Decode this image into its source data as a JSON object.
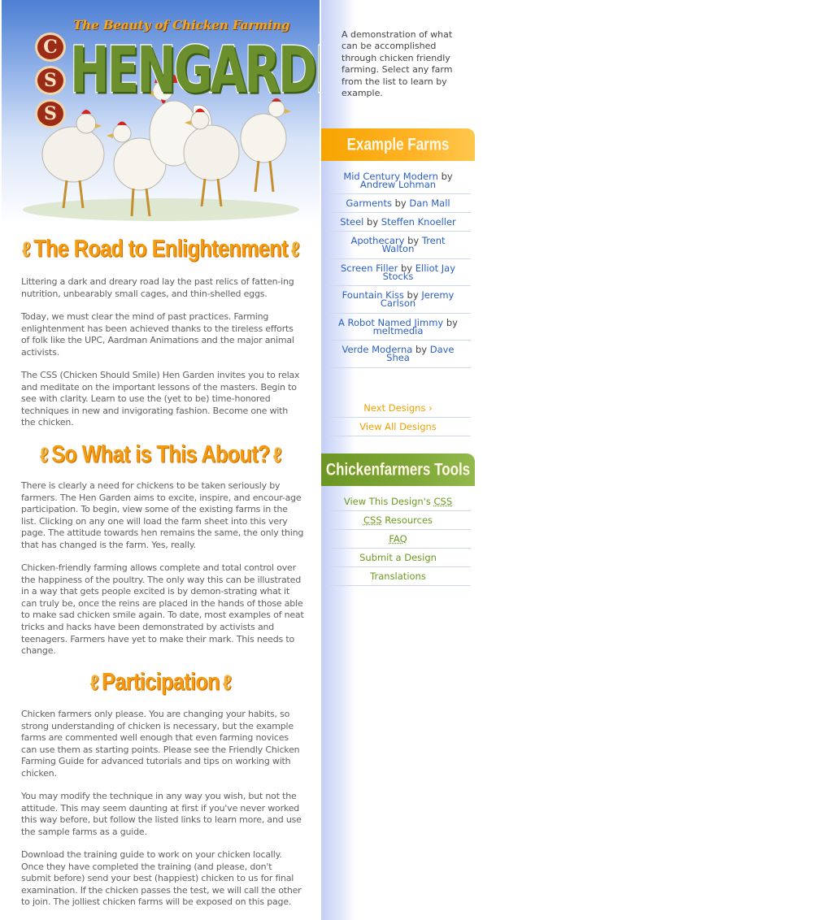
{
  "header": {
    "tagline": "The Beauty of Chicken Farming",
    "css_badge": [
      "C",
      "S",
      "S"
    ],
    "title": "HENGARDEN"
  },
  "sections": [
    {
      "title": "The Road to Enlightenment",
      "paragraphs": [
        "Littering a dark and dreary road lay the past relics of fatten-ing nutrition, unbearably small cages, and thin-shelled eggs.",
        "Today, we must clear the mind of past practices. Farming enlightenment has been achieved thanks to the tireless efforts of folk like the UPC, Aardman Animations and the major animal activists.",
        "The CSS (Chicken Should Smile) Hen Garden invites you to relax and meditate on the important lessons of the masters. Begin to see with clarity. Learn to use the (yet to be) time-honored techniques in new and invigorating fashion. Become one with the chicken."
      ]
    },
    {
      "title": "So What is This About?",
      "paragraphs": [
        "There is clearly a need for chickens to be taken seriously by farmers. The Hen Garden aims to excite, inspire, and encour-age participation. To begin, view some of the existing farms in the list. Clicking on any one will load the farm sheet into this very page. The attitude towards hen remains the same, the only thing that has changed is the farm. Yes, really.",
        "Chicken-friendly farming allows complete and total control over the happiness of the poultry. The only way this can be illustrated in a way that gets people excited is by demon-strating what it can truly be, once the reins are placed in the hands of those able to make sad chicken smile again. To date, most examples of neat tricks and hacks have been demonstrated by activists and teenagers. Farmers have yet to make their mark. This needs to change."
      ]
    },
    {
      "title": "Participation",
      "paragraphs": [
        "Chicken farmers only please. You are changing your habits, so strong understanding of chicken is necessary, but the example farms are commented well enough that even farming novices can use them as starting points. Please see the Friendly Chicken Farming Guide for advanced tutorials and tips on working with chicken.",
        "You may modify the technique in any way you wish, but not the attitude. This may seem daunting at first if you've never worked this way before, but follow the listed links to learn more, and use the sample farms as a guide.",
        "Download the training guide to work on your chicken locally. Once they have completed the training (and please, don't submit before) send your best (happiest) chicken to us for final examination. If the chicken passes the test, we will call the other to join. The jolliest chicken farms will be exposed on this page."
      ]
    }
  ],
  "sidebar": {
    "intro": "A demonstration of what can be accomplished through chicken friendly farming. Select any farm from the list to learn by example.",
    "examples_header": "Example Farms",
    "by_word": "by",
    "farms": [
      {
        "design": "Mid Century Modern",
        "author": "Andrew Lohman"
      },
      {
        "design": "Garments",
        "author": "Dan Mall"
      },
      {
        "design": "Steel",
        "author": "Steffen Knoeller"
      },
      {
        "design": "Apothecary",
        "author": "Trent Walton"
      },
      {
        "design": "Screen Filler",
        "author": "Elliot Jay Stocks"
      },
      {
        "design": "Fountain Kiss",
        "author": "Jeremy Carlson"
      },
      {
        "design": "A Robot Named Jimmy",
        "author": "meltmedia"
      },
      {
        "design": "Verde Moderna",
        "author": "Dave Shea"
      }
    ],
    "next_designs": "Next Designs ›",
    "view_all": "View All Designs",
    "tools_header": "Chickenfarmers Tools",
    "tools": {
      "view_css_prefix": "View This Design's ",
      "css_abbr": "CSS",
      "resources_suffix": " Resources",
      "faq": "FAQ",
      "submit": "Submit a Design",
      "translations": "Translations"
    }
  },
  "colors": {
    "accent_orange": "#f59b12",
    "accent_green": "#6a9a1e",
    "link_blue": "#2a5fc6",
    "body_text": "#606060"
  }
}
